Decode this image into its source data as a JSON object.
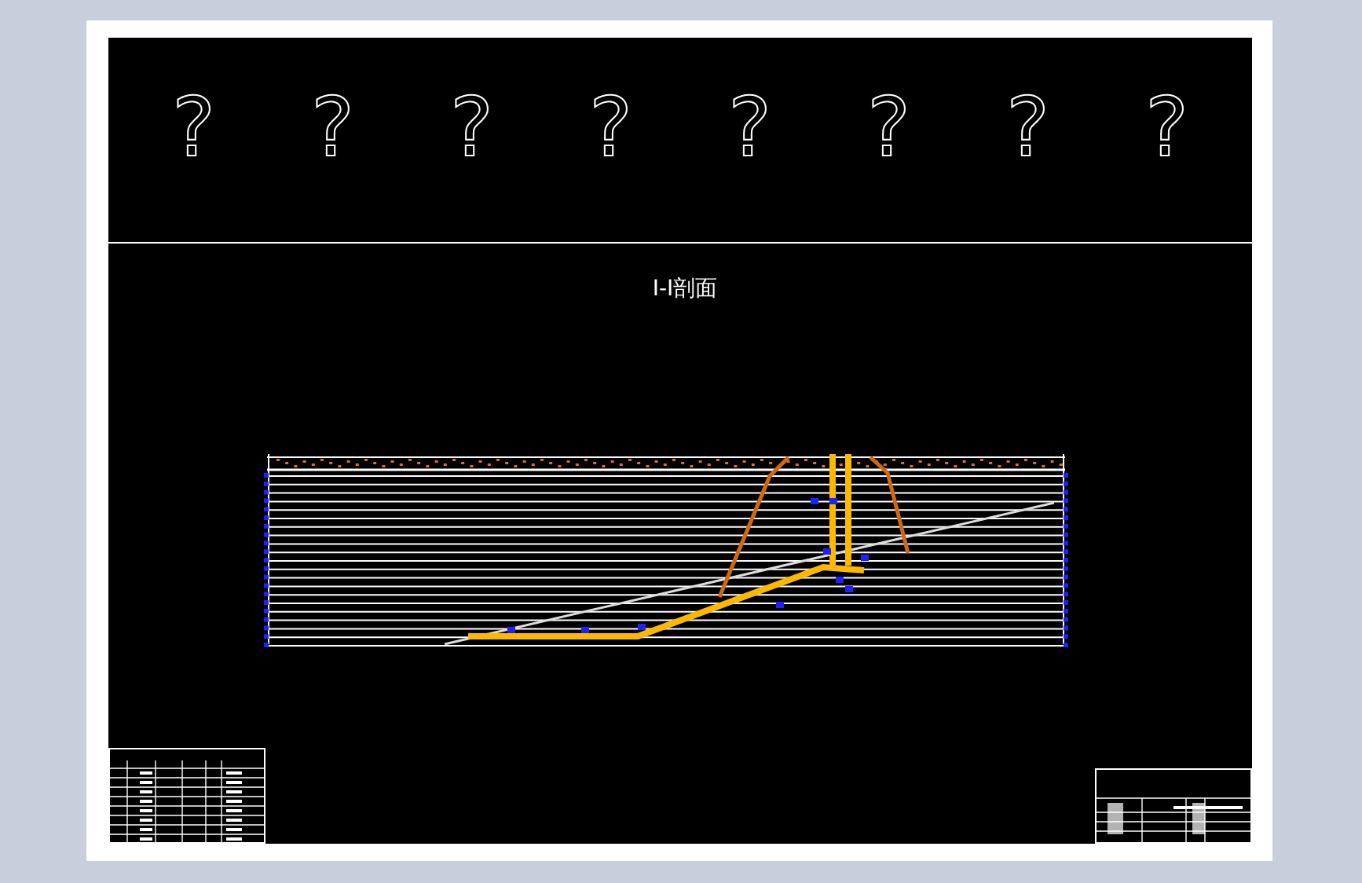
{
  "symbols": [
    "?",
    "?",
    "?",
    "?",
    "?",
    "?",
    "?",
    "?"
  ],
  "section_title": "I-I剖面"
}
